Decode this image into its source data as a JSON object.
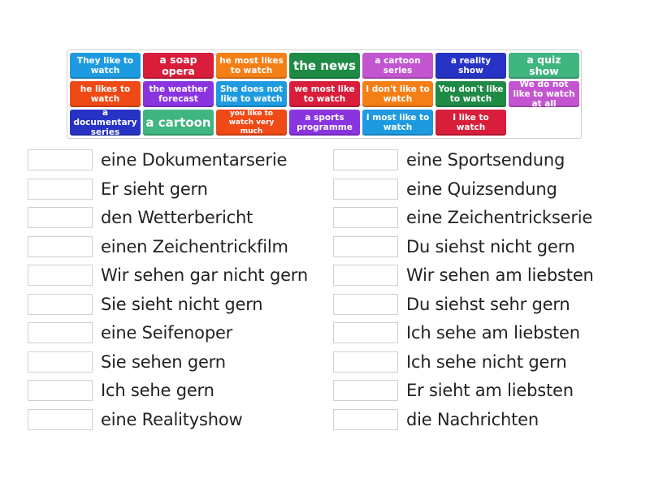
{
  "tiles": [
    {
      "label": "They like to watch",
      "color": "#1e9be0"
    },
    {
      "label": "a soap opera",
      "color": "#d81e3a"
    },
    {
      "label": "he most likes to watch",
      "color": "#f57f17"
    },
    {
      "label": "the news",
      "color": "#1f8a46"
    },
    {
      "label": "a cartoon series",
      "color": "#c356d0"
    },
    {
      "label": "a reality show",
      "color": "#2733c4"
    },
    {
      "label": "a quiz show",
      "color": "#3fb57f"
    },
    {
      "label": "he likes to watch",
      "color": "#ef4a16"
    },
    {
      "label": "the weather forecast",
      "color": "#8a34e0"
    },
    {
      "label": "She does not like to watch",
      "color": "#1e9be0"
    },
    {
      "label": "we most like to watch",
      "color": "#d81e3a"
    },
    {
      "label": "I don't like to watch",
      "color": "#f57f17"
    },
    {
      "label": "You don't like to watch",
      "color": "#1f8a46"
    },
    {
      "label": "We do not like to watch at all",
      "color": "#c356d0"
    },
    {
      "label": "a documentary series",
      "color": "#2733c4"
    },
    {
      "label": "a cartoon",
      "color": "#3fb57f"
    },
    {
      "label": "you like to watch very much",
      "color": "#ef4a16"
    },
    {
      "label": "a sports programme",
      "color": "#8a34e0"
    },
    {
      "label": "I most like to watch",
      "color": "#1e9be0"
    },
    {
      "label": "I like to watch",
      "color": "#d81e3a"
    }
  ],
  "left_items": [
    "eine Dokumentarserie",
    "Er sieht gern",
    "den Wetterbericht",
    "einen Zeichentrickfilm",
    "Wir sehen gar nicht gern",
    "Sie sieht nicht gern",
    "eine Seifenoper",
    "Sie sehen gern",
    "Ich sehe gern",
    "eine Realityshow"
  ],
  "right_items": [
    "eine Sportsendung",
    "eine Quizsendung",
    "eine Zeichentrickserie",
    "Du siehst nicht gern",
    "Wir sehen am liebsten",
    "Du siehst sehr gern",
    "Ich sehe am liebsten",
    "Ich sehe nicht gern",
    "Er sieht am liebsten",
    "die Nachrichten"
  ]
}
